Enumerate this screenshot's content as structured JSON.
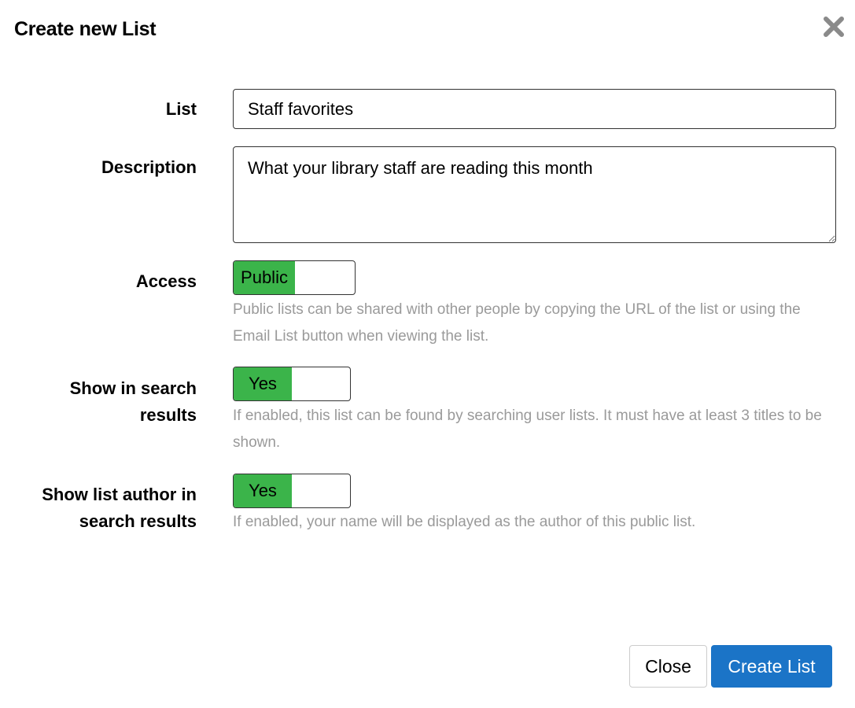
{
  "dialog": {
    "title": "Create new List",
    "close_icon": "close-icon"
  },
  "form": {
    "list": {
      "label": "List",
      "value": "Staff favorites"
    },
    "description": {
      "label": "Description",
      "value": "What your library staff are reading this month"
    },
    "access": {
      "label": "Access",
      "toggle_text": "Public",
      "help": "Public lists can be shared with other people by copying the URL of the list or using the Email List button when viewing the list."
    },
    "show_in_search": {
      "label_line1": "Show in search",
      "label_line2": "results",
      "toggle_text": "Yes",
      "help": "If enabled, this list can be found by searching user lists. It must have at least 3 titles to be shown."
    },
    "show_author": {
      "label_line1": "Show list author in",
      "label_line2": "search results",
      "toggle_text": "Yes",
      "help": "If enabled, your name will be displayed as the author of this public list."
    }
  },
  "footer": {
    "close_label": "Close",
    "create_label": "Create List"
  },
  "colors": {
    "toggle_on": "#3bb44a",
    "primary_button": "#1b74c7",
    "help_text": "#9a9a9a"
  }
}
